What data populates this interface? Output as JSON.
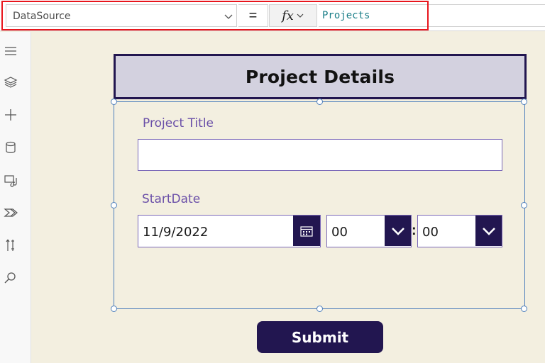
{
  "formula_bar": {
    "property": "DataSource",
    "equals": "=",
    "fx": "fx",
    "formula": "Projects"
  },
  "left_rail": {
    "icons": [
      "hamburger-menu-icon",
      "layers-icon",
      "plus-icon",
      "database-icon",
      "media-icon",
      "power-automate-icon",
      "tools-icon",
      "search-icon"
    ]
  },
  "form": {
    "title": "Project Details",
    "project_title_label": "Project Title",
    "project_title_value": "",
    "start_date_label": "StartDate",
    "date_value": "11/9/2022",
    "hour_value": "00",
    "minute_value": "00",
    "colon": ":",
    "submit_label": "Submit"
  },
  "colors": {
    "accent": "#221650",
    "highlight_border": "#e8161d",
    "canvas_bg": "#f3efe0",
    "label_text": "#6a4fa8",
    "formula_text": "#1a7e88"
  }
}
